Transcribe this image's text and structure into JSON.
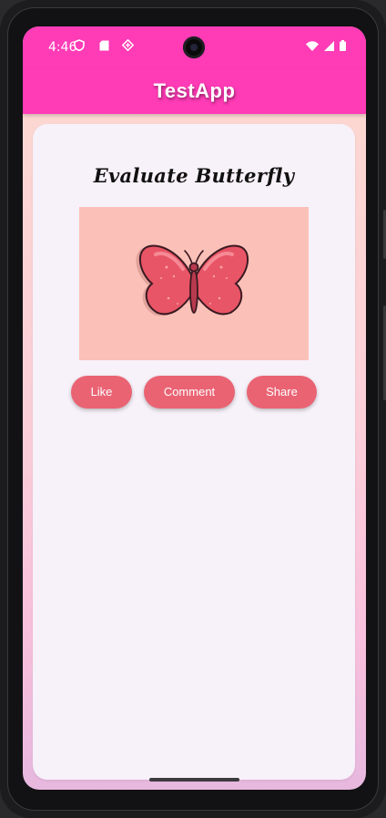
{
  "status_bar": {
    "time": "4:46",
    "left_icons": [
      "shield-icon",
      "sd-card-icon",
      "data-saver-icon"
    ],
    "right_icons": [
      "wifi-icon",
      "signal-icon",
      "battery-icon"
    ]
  },
  "app_bar": {
    "title": "TestApp",
    "color": "#ff3bb6"
  },
  "card": {
    "title": "Evaluate Butterfly",
    "image": "butterfly-illustration",
    "buttons": {
      "like": "Like",
      "comment": "Comment",
      "share": "Share"
    },
    "button_color": "#ea6373"
  }
}
